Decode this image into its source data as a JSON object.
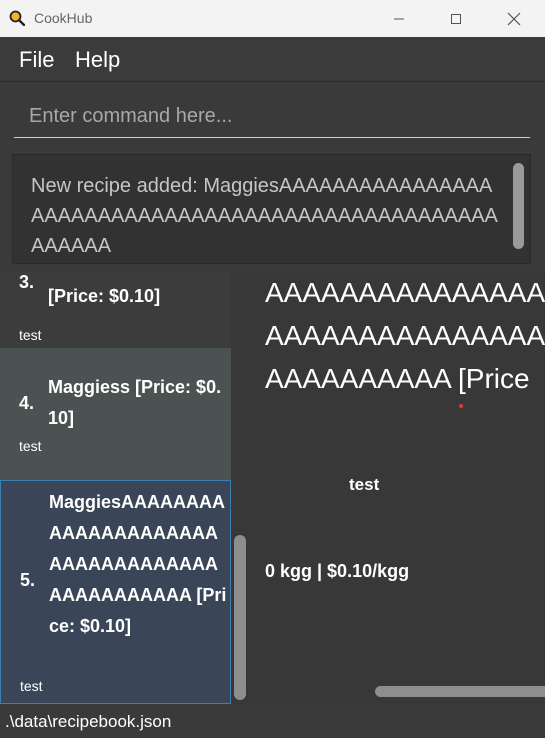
{
  "window": {
    "title": "CookHub",
    "icon": "magnifier-icon"
  },
  "menu": {
    "items": [
      "File",
      "Help"
    ]
  },
  "command": {
    "placeholder": "Enter command here..."
  },
  "result": {
    "text": "New recipe added: MaggiesAAAAAAAAAAAAAAAAAAAAAAAAAAAAAAAAAAAAAAAAAAAAAAAAAAAAAAAAA"
  },
  "recipes": [
    {
      "index": "3.",
      "name": "[Price: $0.10]",
      "tag": "test"
    },
    {
      "index": "4.",
      "name": "Maggiess [Price: $0.10]",
      "tag": "test"
    },
    {
      "index": "5.",
      "name": "MaggiesAAAAAAAAAAAAAAAAAAAAAAAAAAAAAAAAAAAAAAAAAAAAA [Price: $0.10]",
      "tag": "test"
    }
  ],
  "detail": {
    "title_lines": [
      "AAAAAAAAAAAAAAA",
      "AAAAAAAAAAAAAAA",
      "AAAAAAAAAA [Price"
    ],
    "tag": "test",
    "quantity": "0 kgg | $0.10/kgg"
  },
  "status": {
    "path": ".\\data\\recipebook.json"
  }
}
